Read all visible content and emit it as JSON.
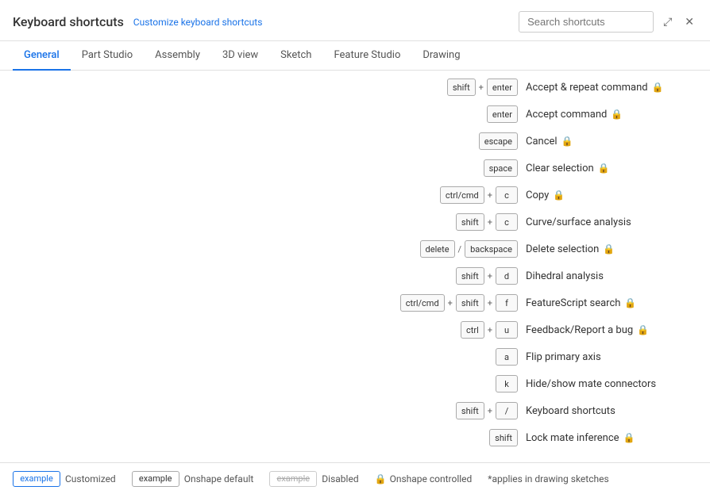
{
  "header": {
    "title": "Keyboard shortcuts",
    "customize_link": "Customize keyboard shortcuts",
    "search_placeholder": "Search shortcuts",
    "expand_icon": "⤢",
    "close_icon": "✕"
  },
  "tabs": [
    {
      "label": "General",
      "active": true
    },
    {
      "label": "Part Studio",
      "active": false
    },
    {
      "label": "Assembly",
      "active": false
    },
    {
      "label": "3D view",
      "active": false
    },
    {
      "label": "Sketch",
      "active": false
    },
    {
      "label": "Feature Studio",
      "active": false
    },
    {
      "label": "Drawing",
      "active": false
    }
  ],
  "shortcuts": [
    {
      "keys": [
        {
          "k": "shift"
        },
        {
          "sep": "+"
        },
        {
          "k": "enter"
        }
      ],
      "label": "Accept & repeat command",
      "locked": true
    },
    {
      "keys": [
        {
          "k": "enter"
        }
      ],
      "label": "Accept command",
      "locked": true
    },
    {
      "keys": [
        {
          "k": "escape"
        }
      ],
      "label": "Cancel",
      "locked": true
    },
    {
      "keys": [
        {
          "k": "space"
        }
      ],
      "label": "Clear selection",
      "locked": true
    },
    {
      "keys": [
        {
          "k": "ctrl/cmd"
        },
        {
          "sep": "+"
        },
        {
          "k": "c"
        }
      ],
      "label": "Copy",
      "locked": true
    },
    {
      "keys": [
        {
          "k": "shift"
        },
        {
          "sep": "+"
        },
        {
          "k": "c"
        }
      ],
      "label": "Curve/surface analysis",
      "locked": false
    },
    {
      "keys": [
        {
          "k": "delete"
        },
        {
          "sep": "/"
        },
        {
          "k": "backspace"
        }
      ],
      "label": "Delete selection",
      "locked": true
    },
    {
      "keys": [
        {
          "k": "shift"
        },
        {
          "sep": "+"
        },
        {
          "k": "d"
        }
      ],
      "label": "Dihedral analysis",
      "locked": false
    },
    {
      "keys": [
        {
          "k": "ctrl/cmd"
        },
        {
          "sep": "+"
        },
        {
          "k": "shift"
        },
        {
          "sep": "+"
        },
        {
          "k": "f"
        }
      ],
      "label": "FeatureScript search",
      "locked": true
    },
    {
      "keys": [
        {
          "k": "ctrl"
        },
        {
          "sep": "+"
        },
        {
          "k": "u"
        }
      ],
      "label": "Feedback/Report a bug",
      "locked": true
    },
    {
      "keys": [
        {
          "k": "a"
        }
      ],
      "label": "Flip primary axis",
      "locked": false
    },
    {
      "keys": [
        {
          "k": "k"
        }
      ],
      "label": "Hide/show mate connectors",
      "locked": false
    },
    {
      "keys": [
        {
          "k": "shift"
        },
        {
          "sep": "+"
        },
        {
          "k": "/"
        }
      ],
      "label": "Keyboard shortcuts",
      "locked": false
    },
    {
      "keys": [
        {
          "k": "shift"
        }
      ],
      "label": "Lock mate inference",
      "locked": true
    }
  ],
  "footer": {
    "legend": [
      {
        "type": "customized",
        "key_label": "example",
        "desc": "Customized"
      },
      {
        "type": "default",
        "key_label": "example",
        "desc": "Onshape default"
      },
      {
        "type": "disabled",
        "key_label": "example",
        "desc": "Disabled"
      }
    ],
    "controlled_label": "Onshape controlled",
    "asterisk_note": "*applies in drawing sketches"
  }
}
